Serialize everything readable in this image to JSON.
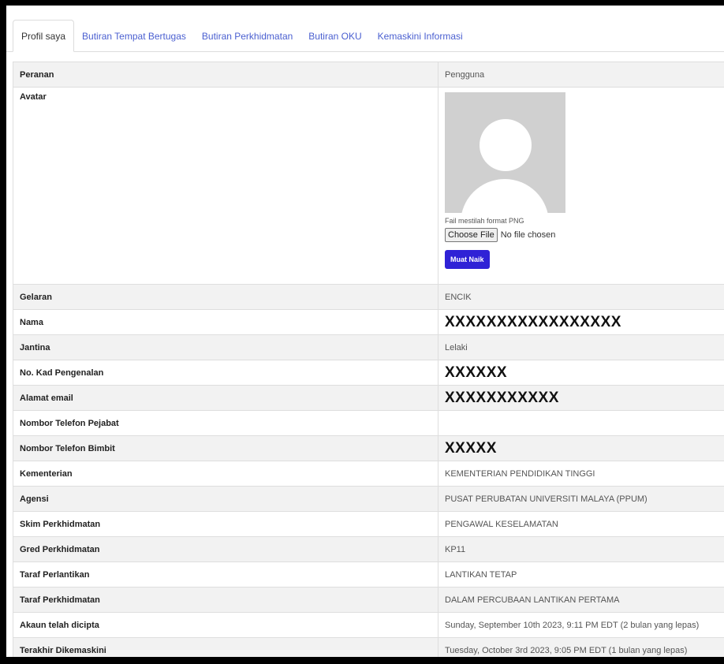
{
  "tabs": [
    {
      "label": "Profil saya",
      "active": true
    },
    {
      "label": "Butiran Tempat Bertugas",
      "active": false
    },
    {
      "label": "Butiran Perkhidmatan",
      "active": false
    },
    {
      "label": "Butiran OKU",
      "active": false
    },
    {
      "label": "Kemaskini Informasi",
      "active": false
    }
  ],
  "profile": {
    "role_label": "Peranan",
    "role_value": "Pengguna",
    "avatar_label": "Avatar",
    "avatar_hint": "Fail mestilah format PNG",
    "choose_file": "Choose File",
    "no_file": "No file chosen",
    "upload_button": "Muat Naik",
    "rows": [
      {
        "label": "Gelaran",
        "value": "ENCIK"
      },
      {
        "label": "Nama",
        "value": "XXXXXXXXXXXXXXXXX",
        "masked": true
      },
      {
        "label": "Jantina",
        "value": "Lelaki"
      },
      {
        "label": "No. Kad Pengenalan",
        "value": "XXXXXX",
        "masked": true
      },
      {
        "label": "Alamat email",
        "value": "XXXXXXXXXXX",
        "masked": true
      },
      {
        "label": "Nombor Telefon Pejabat",
        "value": ""
      },
      {
        "label": "Nombor Telefon Bimbit",
        "value": "XXXXX",
        "masked": true
      },
      {
        "label": "Kementerian",
        "value": "KEMENTERIAN PENDIDIKAN TINGGI"
      },
      {
        "label": "Agensi",
        "value": "PUSAT PERUBATAN UNIVERSITI MALAYA (PPUM)"
      },
      {
        "label": "Skim Perkhidmatan",
        "value": "PENGAWAL KESELAMATAN"
      },
      {
        "label": "Gred Perkhidmatan",
        "value": "KP11"
      },
      {
        "label": "Taraf Perlantikan",
        "value": "LANTIKAN TETAP"
      },
      {
        "label": "Taraf Perkhidmatan",
        "value": "DALAM PERCUBAAN LANTIKAN PERTAMA"
      },
      {
        "label": "Akaun telah dicipta",
        "value": "Sunday, September 10th 2023, 9:11 PM EDT (2 bulan yang lepas)"
      },
      {
        "label": "Terakhir Dikemaskini",
        "value": "Tuesday, October 3rd 2023, 9:05 PM EDT (1 bulan yang lepas)"
      }
    ]
  }
}
